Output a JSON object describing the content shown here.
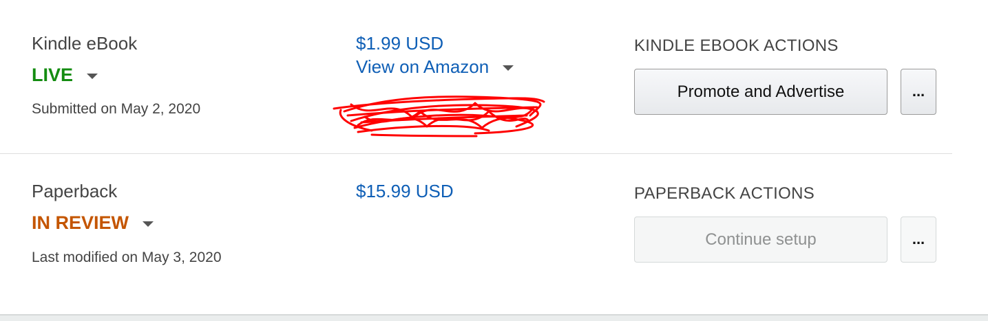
{
  "rows": [
    {
      "format": "Kindle eBook",
      "status": "LIVE",
      "status_color": "#148c11",
      "meta": "Submitted on May 2, 2020",
      "price": "$1.99 USD",
      "link": "View on Amazon",
      "actions_heading": "KINDLE EBOOK ACTIONS",
      "primary_action": "Promote and Advertise",
      "more_label": "..."
    },
    {
      "format": "Paperback",
      "status": "IN REVIEW",
      "status_color": "#c45500",
      "meta": "Last modified on May 3, 2020",
      "price": "$15.99 USD",
      "actions_heading": "PAPERBACK ACTIONS",
      "primary_action": "Continue setup",
      "more_label": "..."
    }
  ],
  "colors": {
    "link": "#0f5fb6",
    "redaction": "#ff0000"
  },
  "icons": [
    "caret-down-icon",
    "more-options-icon"
  ]
}
